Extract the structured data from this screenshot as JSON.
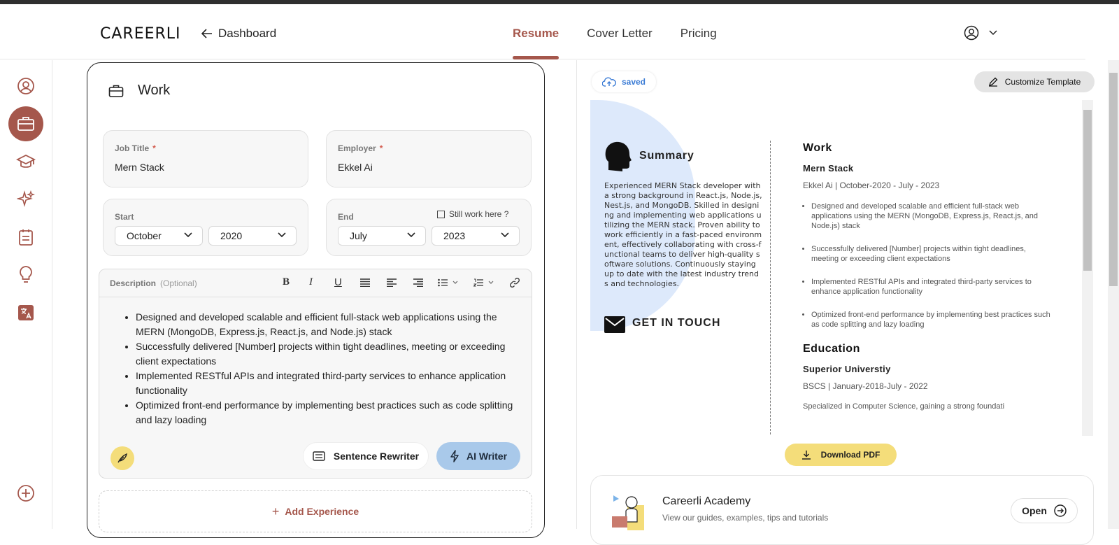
{
  "header": {
    "logo": "CAREERLI",
    "back_label": "Dashboard",
    "nav": [
      "Resume",
      "Cover Letter",
      "Pricing"
    ]
  },
  "sidebar": {
    "items": [
      "profile-icon",
      "briefcase-icon",
      "graduation-cap-icon",
      "sparkles-icon",
      "calendar-icon",
      "lightbulb-icon",
      "translate-icon",
      "add-icon"
    ]
  },
  "work": {
    "title": "Work",
    "job_title_label": "Job Title",
    "job_title_value": "Mern Stack",
    "employer_label": "Employer",
    "employer_value": "Ekkel Ai",
    "required_mark": "*",
    "start_label": "Start",
    "start_month": "October",
    "start_year": "2020",
    "end_label": "End",
    "end_month": "July",
    "end_year": "2023",
    "still_work_label": "Still work here ?",
    "description_label": "Description",
    "description_optional": "(Optional)",
    "bullets": [
      "Designed and developed scalable and efficient full-stack web applications using the MERN (MongoDB, Express.js, React.js, and Node.js) stack",
      "Successfully delivered [Number] projects within tight deadlines, meeting or exceeding client expectations",
      "Implemented RESTful APIs and integrated third-party services to enhance application functionality",
      "Optimized front-end performance by implementing best practices such as code splitting and lazy loading"
    ],
    "sentence_rewriter_label": "Sentence Rewriter",
    "ai_writer_label": "AI Writer",
    "add_experience_label": "Add Experience"
  },
  "preview_toolbar": {
    "saved_label": "saved",
    "customize_label": "Customize Template"
  },
  "resume_preview": {
    "summary_title": "Summary",
    "summary_text": "Experienced MERN Stack developer with a strong background in React.js, Node.js, Nest.js, and MongoDB. Skilled in designing and implementing web applications utilizing the MERN stack. Proven ability to work efficiently in a fast-paced environment, effectively collaborating with cross-functional teams to deliver high-quality software solutions. Continuously staying up to date with the latest industry trends and technologies.",
    "contact_title": "GET IN TOUCH",
    "work_heading": "Work",
    "work_position": "Mern Stack",
    "work_meta": "Ekkel Ai | October-2020 - July - 2023",
    "work_bullets": [
      "Designed and developed scalable and efficient full-stack web applications using the MERN (MongoDB, Express.js, React.js, and Node.js) stack",
      "Successfully delivered [Number] projects within tight deadlines, meeting or exceeding client expectations",
      "Implemented RESTful APIs and integrated third-party services to enhance application functionality",
      "Optimized front-end performance by implementing best practices such as code splitting and lazy loading"
    ],
    "education_heading": "Education",
    "education_school": "Superior Universtiy",
    "education_meta": "BSCS | January-2018-July - 2022",
    "education_text": "Specialized in Computer Science, gaining a strong foundati"
  },
  "download_label": "Download PDF",
  "academy": {
    "title": "Careerli Academy",
    "subtitle": "View our guides, examples, tips and tutorials",
    "open_label": "Open"
  },
  "colors": {
    "accent": "#a5574c",
    "ai_button": "#a9c9ea",
    "yellow": "#f4dd7a",
    "preview_blue": "#dde9fb"
  }
}
